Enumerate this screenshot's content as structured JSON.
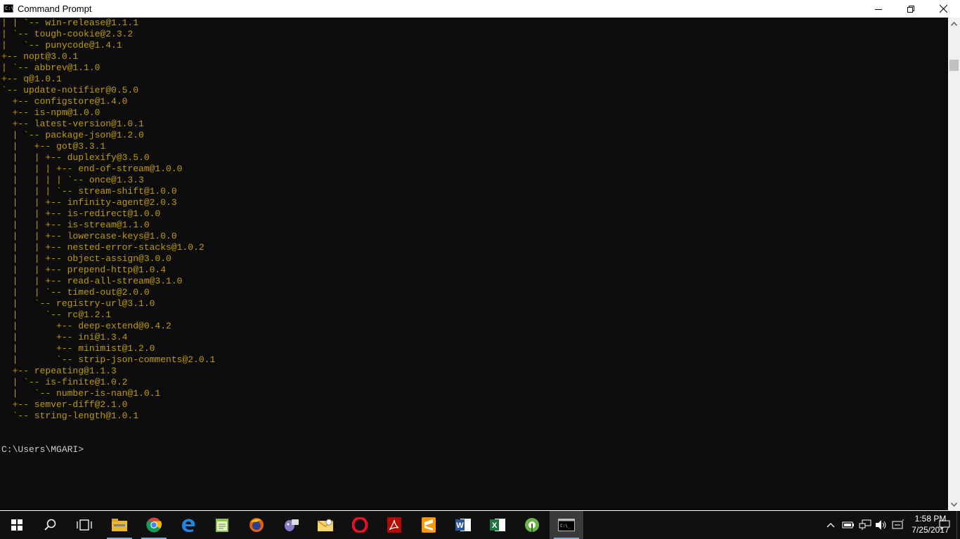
{
  "window": {
    "title": "Command Prompt"
  },
  "console": {
    "lines": [
      "| | `-- win-release@1.1.1",
      "| `-- tough-cookie@2.3.2",
      "|   `-- punycode@1.4.1",
      "+-- nopt@3.0.1",
      "| `-- abbrev@1.1.0",
      "+-- q@1.0.1",
      "`-- update-notifier@0.5.0",
      "  +-- configstore@1.4.0",
      "  +-- is-npm@1.0.0",
      "  +-- latest-version@1.0.1",
      "  | `-- package-json@1.2.0",
      "  |   +-- got@3.3.1",
      "  |   | +-- duplexify@3.5.0",
      "  |   | | +-- end-of-stream@1.0.0",
      "  |   | | | `-- once@1.3.3",
      "  |   | | `-- stream-shift@1.0.0",
      "  |   | +-- infinity-agent@2.0.3",
      "  |   | +-- is-redirect@1.0.0",
      "  |   | +-- is-stream@1.1.0",
      "  |   | +-- lowercase-keys@1.0.0",
      "  |   | +-- nested-error-stacks@1.0.2",
      "  |   | +-- object-assign@3.0.0",
      "  |   | +-- prepend-http@1.0.4",
      "  |   | +-- read-all-stream@3.1.0",
      "  |   | `-- timed-out@2.0.0",
      "  |   `-- registry-url@3.1.0",
      "  |     `-- rc@1.2.1",
      "  |       +-- deep-extend@0.4.2",
      "  |       +-- ini@1.3.4",
      "  |       +-- minimist@1.2.0",
      "  |       `-- strip-json-comments@2.0.1",
      "  +-- repeating@1.1.3",
      "  | `-- is-finite@1.0.2",
      "  |   `-- number-is-nan@1.0.1",
      "  +-- semver-diff@2.1.0",
      "  `-- string-length@1.0.1"
    ],
    "prompt": "C:\\Users\\MGARI>"
  },
  "colors": {
    "console_text": "#c19c00",
    "console_bg": "#0c0c0c",
    "prompt_text": "#cccccc",
    "taskbar_bg": "#101010"
  },
  "taskbar": {
    "apps": [
      "start-windows-icon",
      "search-icon",
      "task-view-icon",
      "file-explorer-icon",
      "chrome-icon",
      "edge-icon",
      "notepad-plus-plus-icon",
      "firefox-icon",
      "pidgin-icon",
      "outlook-icon",
      "opera-icon",
      "acrobat-icon",
      "sublime-text-icon",
      "word-icon",
      "excel-icon",
      "android-studio-icon",
      "command-prompt-icon"
    ],
    "clock_time": "1:58 PM",
    "clock_date": "7/25/2017"
  }
}
